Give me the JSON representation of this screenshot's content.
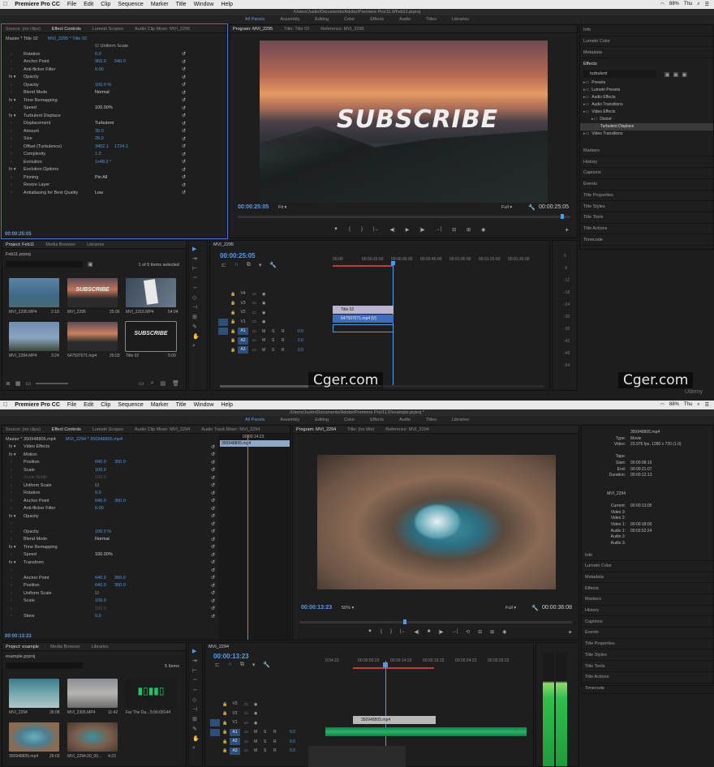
{
  "mac": {
    "app": "Premiere Pro CC",
    "menus": [
      "File",
      "Edit",
      "Clip",
      "Sequence",
      "Marker",
      "Title",
      "Window",
      "Help"
    ],
    "battery": "88%",
    "day": "Thu"
  },
  "top": {
    "title": "/Users/Justin/Documents/Adobe/Premiere Pro/11.0/Feb11.prproj",
    "workspaces": [
      "All Panels",
      "Assembly",
      "Editing",
      "Color",
      "Effects",
      "Audio",
      "Titles",
      "Libraries"
    ],
    "ec_tabs": [
      "Source: (no clips)",
      "Effect Controls",
      "Lumetri Scopes",
      "Audio Clip Mixer: MVI_2295"
    ],
    "master": "Master * Title 02",
    "seq_clip": "MVI_2295 * Title 02",
    "ec_rows": [
      {
        "label": "Rotation",
        "v": "0.0"
      },
      {
        "label": "Anchor Point",
        "v": "960.0",
        "v2": "540.0"
      },
      {
        "label": "Anti-flicker Filter",
        "v": "0.00"
      },
      {
        "label": "Opacity",
        "h": true
      },
      {
        "label": "Opacity",
        "v": "100.0 %"
      },
      {
        "label": "Blend Mode",
        "v": "Normal",
        "white": true
      },
      {
        "label": "Time Remapping",
        "h": true
      },
      {
        "label": "Speed",
        "v": "100.00%",
        "white": true
      },
      {
        "label": "Turbulent Displace",
        "h": true
      },
      {
        "label": "Displacement",
        "v": "Turbulent",
        "white": true
      },
      {
        "label": "Amount",
        "v": "30.0"
      },
      {
        "label": "Size",
        "v": "29.0"
      },
      {
        "label": "Offset (Turbulence)",
        "v": "3402.1",
        "v2": "1724.1"
      },
      {
        "label": "Complexity",
        "v": "1.0"
      },
      {
        "label": "Evolution",
        "v": "1x48.0 °"
      },
      {
        "label": "Evolution Options",
        "h": true
      },
      {
        "label": "Pinning",
        "v": "Pin All",
        "white": true
      },
      {
        "label": "Resize Layer",
        "v": "",
        "white": true
      },
      {
        "label": "Antialiasing for Best Quality",
        "v": "Low",
        "white": true
      }
    ],
    "uniform": "Uniform Scale",
    "ec_tc": "00:00:25:05",
    "prog_tabs": [
      "Program: MVI_2295",
      "Title: Title 02",
      "Reference: MVI_2295"
    ],
    "subscribe": "SUBSCRIBE",
    "prog_tc": "00:00:25:05",
    "fit": "Fit",
    "full": "Full",
    "prog_end": "00:00:25:05",
    "right_top": [
      "Info",
      "Lumetri Color",
      "Metadata",
      "Effects"
    ],
    "fx_search": "turbulent",
    "fx_tree": [
      "Presets",
      "Lumetri Presets",
      "Audio Effects",
      "Audio Transitions",
      "Video Effects",
      "Distort",
      "Turbulent Displace",
      "Video Transitions"
    ],
    "right_bottom": [
      "Markers",
      "History",
      "Captions",
      "Events",
      "Title Properties",
      "Title Styles",
      "Title Tools",
      "Title Actions",
      "Timecode"
    ],
    "proj_tabs": [
      "Project: Feb11",
      "Media Browser",
      "Libraries"
    ],
    "proj_file": "Feb11.prproj",
    "proj_count": "1 of 6 items selected",
    "items": [
      {
        "name": "MVI_2295.MP4",
        "dur": "2:18"
      },
      {
        "name": "MVI_2295",
        "dur": "25:06"
      },
      {
        "name": "MVI_2316.MP4",
        "dur": "54:04"
      },
      {
        "name": "MVI_2284.MP4",
        "dur": "3:24"
      },
      {
        "name": "647597071.mp4",
        "dur": "25:03"
      },
      {
        "name": "Title 02",
        "dur": "5:00"
      }
    ],
    "seq_tab": "MVI_2295",
    "seq_tc": "00:00:25:05",
    "ruler": [
      "00:00",
      "00:00:15:00",
      "00:00:30:00",
      "00:00:45:00",
      "00:01:00:00",
      "00:01:15:00",
      "00:01:30:00"
    ],
    "tracks": [
      "V4",
      "V3",
      "V2",
      "V1",
      "A1",
      "A2",
      "A3"
    ],
    "clip_title": "Title 02",
    "clip_vid": "647597071.mp4 [V]",
    "vol": "0.0",
    "meter": [
      "0",
      "-6",
      "-12",
      "-18",
      "-24",
      "-30",
      "-36",
      "-42",
      "-48",
      "-54"
    ],
    "wm": "Cger.com",
    "udemy": "Udemy"
  },
  "bottom": {
    "title": "/Users/Justin/Documents/Adobe/Premiere Pro/11.0/example.prproj *",
    "ec_tabs": [
      "Source: (no clips)",
      "Effect Controls",
      "Lumetri Scopes",
      "Audio Clip Mixer: MVI_2294",
      "Audio Track Mixer: MVI_2294"
    ],
    "master": "Master * 350948805.mp4",
    "seq_clip": "MVI_2294 * 350948805.mp4",
    "mini_tc": "00:00:14:23",
    "mini_clip": "350948805.mp4",
    "ec_rows": [
      {
        "label": "Video Effects",
        "h": true
      },
      {
        "label": "Motion",
        "h": true
      },
      {
        "label": "Position",
        "v": "640.0",
        "v2": "360.0"
      },
      {
        "label": "Scale",
        "v": "100.0"
      },
      {
        "label": "Scale Width",
        "v": "100.0",
        "dim": true
      },
      {
        "label": "Uniform Scale",
        "v": "",
        "check": true
      },
      {
        "label": "Rotation",
        "v": "0.0"
      },
      {
        "label": "Anchor Point",
        "v": "640.0",
        "v2": "360.0"
      },
      {
        "label": "Anti-flicker Filter",
        "v": "0.00"
      },
      {
        "label": "Opacity",
        "h": true
      },
      {
        "label": "",
        "v": ""
      },
      {
        "label": "Opacity",
        "v": "100.0 %"
      },
      {
        "label": "Blend Mode",
        "v": "Normal",
        "white": true
      },
      {
        "label": "Time Remapping",
        "h": true
      },
      {
        "label": "Speed",
        "v": "100.00%",
        "white": true
      },
      {
        "label": "Transform",
        "h": true
      },
      {
        "label": "",
        "v": ""
      },
      {
        "label": "Anchor Point",
        "v": "640.0",
        "v2": "360.0"
      },
      {
        "label": "Position",
        "v": "640.0",
        "v2": "360.0"
      },
      {
        "label": "Uniform Scale",
        "v": "",
        "check": true
      },
      {
        "label": "Scale",
        "v": "100.0"
      },
      {
        "label": "",
        "v": "100.0",
        "dim": true
      },
      {
        "label": "Skew",
        "v": "0.0"
      }
    ],
    "ec_tc": "00:00:13:23",
    "prog_tabs": [
      "Program: MVI_2294",
      "Title: (no title)",
      "Reference: MVI_2294"
    ],
    "prog_tc": "00:00:13:23",
    "zoom": "50%",
    "full": "Full",
    "prog_end": "00:00:36:08",
    "info": [
      [
        "",
        "350948805.mp4"
      ],
      [
        "Type:",
        "Movie"
      ],
      [
        "Video:",
        "23.976 fps, 1280 x 720 (1.0)"
      ],
      [
        "",
        ""
      ],
      [
        "Tape:",
        ""
      ],
      [
        "Start:",
        "00:00:08:19"
      ],
      [
        "End:",
        "00:00:21:07"
      ],
      [
        "Duration:",
        "00:00:12:13"
      ],
      [
        "",
        ""
      ],
      [
        "",
        ""
      ],
      [
        "MVI_2294",
        ""
      ],
      [
        "",
        ""
      ],
      [
        "Current:",
        "00:00:13:05"
      ],
      [
        "Video 3:",
        ""
      ],
      [
        "Video 2:",
        ""
      ],
      [
        "Video 1:",
        "00:00:18:00"
      ],
      [
        "Audio 1:",
        "00:03:52:24"
      ],
      [
        "Audio 2:",
        ""
      ],
      [
        "Audio 3:",
        ""
      ]
    ],
    "right": [
      "Info",
      "Lumetri Color",
      "Metadata",
      "Effects",
      "Markers",
      "History",
      "Captions",
      "Events",
      "Title Properties",
      "Title Styles",
      "Title Tools",
      "Title Actions",
      "Timecode"
    ],
    "proj_tabs": [
      "Project: example",
      "Media Browser",
      "Libraries"
    ],
    "proj_file": "example.prproj",
    "proj_count": "5 Items",
    "items": [
      {
        "name": "MVI_2294",
        "dur": "36:08"
      },
      {
        "name": "MVI_2305.MP4",
        "dur": "11:42"
      },
      {
        "name": "Far The Da...",
        "dur": "5:06:09144"
      },
      {
        "name": "350948805.mp4",
        "dur": "26:03"
      },
      {
        "name": "MVI_2294.00_00...",
        "dur": "4:23"
      }
    ],
    "seq_tab": "MVI_2294",
    "seq_tc": "00:00:13:23",
    "ruler": [
      "0:04:23",
      "00:00:09:23",
      "00:00:14:23",
      "00:00:19:23",
      "00:00:24:23",
      "00:00:29:23"
    ],
    "tracks": [
      "V3",
      "V2",
      "V1",
      "A1",
      "A2",
      "A3"
    ],
    "clip": "350948805.mp4",
    "vol": "0.0"
  },
  "colors": {
    "accent": "#4d9be6",
    "panel": "#1e1e1e",
    "clip_purple": "#7d6fb5",
    "clip_blue": "#3e6fb5",
    "audio_green": "#1fa560"
  }
}
